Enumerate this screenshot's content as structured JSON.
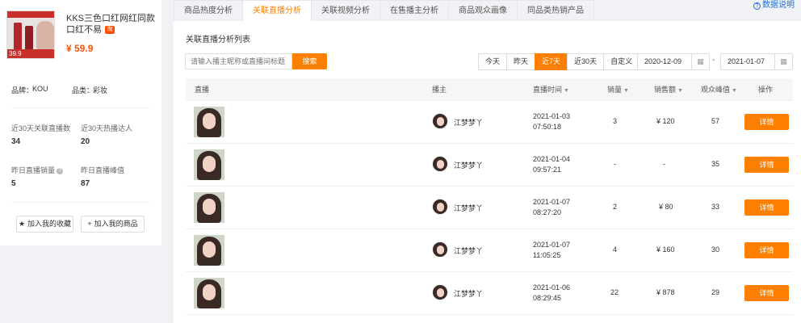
{
  "product": {
    "title": "KKS三色口红网红同款口红不易",
    "badge": "淘",
    "price": "¥ 59.9",
    "image_price": "39.9",
    "brand_label": "品牌：",
    "brand": "KOU",
    "category_label": "品类：",
    "category": "彩妆"
  },
  "stats": [
    {
      "label": "近30天关联直播数",
      "value": "34"
    },
    {
      "label": "近30天热播达人",
      "value": "20"
    },
    {
      "label": "昨日直播销量",
      "value": "5"
    },
    {
      "label": "昨日直播峰值",
      "value": "87"
    }
  ],
  "actions": {
    "favorite": "加入我的收藏",
    "my_goods": "加入我的商品"
  },
  "tabs": [
    "商品热度分析",
    "关联直播分析",
    "关联视频分析",
    "在售播主分析",
    "商品观众画像",
    "同品类热销产品"
  ],
  "active_tab": 1,
  "help_link": "数据说明",
  "section_title": "关联直播分析列表",
  "search": {
    "placeholder": "请输入播主昵称或直播间标题",
    "button": "搜索"
  },
  "ranges": [
    "今天",
    "昨天",
    "近7天",
    "近30天",
    "自定义"
  ],
  "active_range": 2,
  "date_from": "2020-12-09",
  "date_to": "2021-01-07",
  "date_sep": "-",
  "columns": [
    "直播",
    "播主",
    "直播时间",
    "销量",
    "销售额",
    "观众峰值",
    "操作"
  ],
  "rows": [
    {
      "host": "江梦梦丫",
      "date": "2021-01-03",
      "time": "07:50:18",
      "sales": "3",
      "amount": "¥ 120",
      "peak": "57",
      "action": "详情"
    },
    {
      "host": "江梦梦丫",
      "date": "2021-01-04",
      "time": "09:57:21",
      "sales": "-",
      "amount": "-",
      "peak": "35",
      "action": "详情"
    },
    {
      "host": "江梦梦丫",
      "date": "2021-01-07",
      "time": "08:27:20",
      "sales": "2",
      "amount": "¥ 80",
      "peak": "33",
      "action": "详情"
    },
    {
      "host": "江梦梦丫",
      "date": "2021-01-07",
      "time": "11:05:25",
      "sales": "4",
      "amount": "¥ 160",
      "peak": "30",
      "action": "详情"
    },
    {
      "host": "江梦梦丫",
      "date": "2021-01-06",
      "time": "08:29:45",
      "sales": "22",
      "amount": "¥ 878",
      "peak": "29",
      "action": "详情"
    }
  ]
}
